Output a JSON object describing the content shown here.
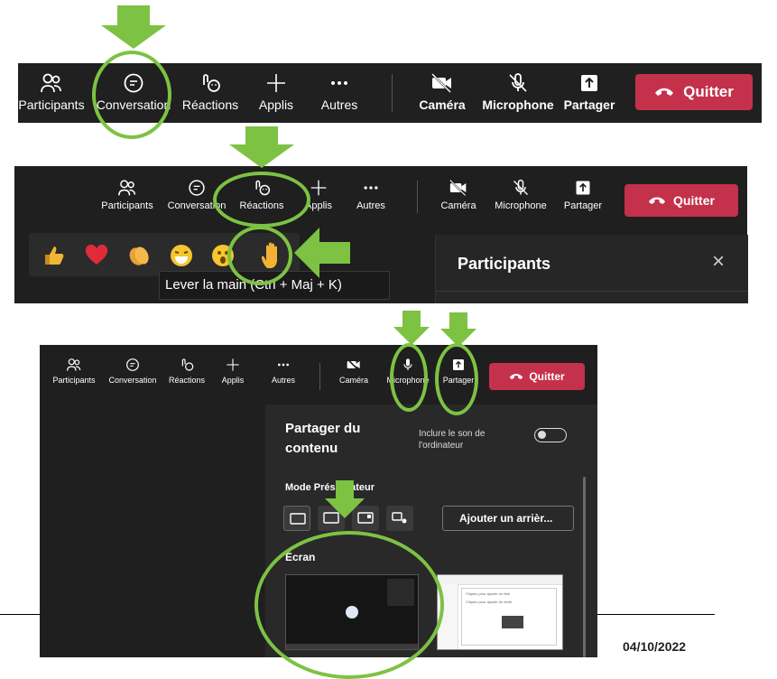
{
  "toolbar": {
    "participants": "Participants",
    "conversation": "Conversation",
    "reactions": "Réactions",
    "apps": "Applis",
    "more": "Autres",
    "camera": "Caméra",
    "microphone": "Microphone",
    "share": "Partager",
    "quit": "Quitter"
  },
  "reactions_panel": {
    "tooltip": "Lever la main (Ctrl + Maj + K)",
    "participants_title": "Participants",
    "close_glyph": "×",
    "emoji_icons": [
      "thumbs-up-icon",
      "heart-icon",
      "clap-icon",
      "laugh-icon",
      "surprised-icon",
      "raise-hand-icon"
    ]
  },
  "share_panel": {
    "title_line1": "Partager du",
    "title_line2": "contenu",
    "include_sound_line1": "Inclure le son de",
    "include_sound_line2": "l'ordinateur",
    "presenter_mode": "Mode Présentateur",
    "add_background": "Ajouter un arrièr...",
    "screen_label": "Écran",
    "window_thumb_line1": "Cliquez pour ajouter un titre",
    "window_thumb_line2": "Cliquez pour ajouter du texte"
  },
  "footer": {
    "date": "04/10/2022"
  },
  "colors": {
    "accent_green": "#7dc243",
    "quit_red": "#c4314b",
    "dark_bg": "#1f1f1f"
  }
}
